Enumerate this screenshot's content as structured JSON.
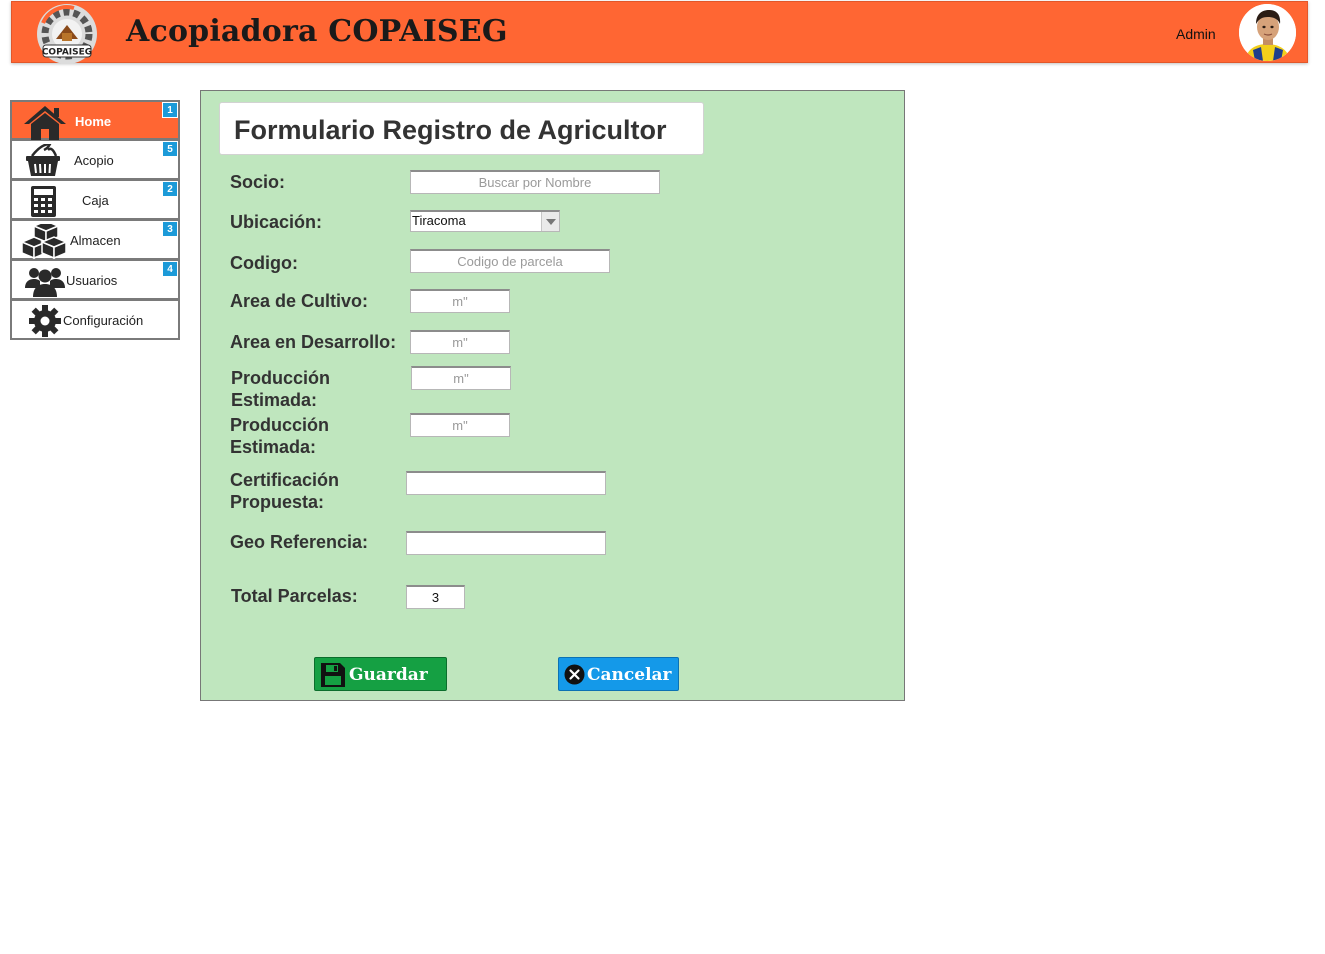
{
  "header": {
    "title": "Acopiadora COPAISEG",
    "logo_text": "COPAISEG",
    "user_label": "Admin",
    "bg_color": "#ff6633"
  },
  "sidebar": {
    "items": [
      {
        "label": "Home",
        "badge": "1",
        "icon": "home-icon",
        "active": true
      },
      {
        "label": "Acopio",
        "badge": "5",
        "icon": "basket-icon",
        "active": false
      },
      {
        "label": "Caja",
        "badge": "2",
        "icon": "calculator-icon",
        "active": false
      },
      {
        "label": "Almacen",
        "badge": "3",
        "icon": "boxes-icon",
        "active": false
      },
      {
        "label": "Usuarios",
        "badge": "4",
        "icon": "users-icon",
        "active": false
      },
      {
        "label": "Configuración",
        "badge": "",
        "icon": "gear-icon",
        "active": false
      }
    ],
    "active_color": "#ff6633",
    "badge_color": "#1c9ad8"
  },
  "form": {
    "title": "Formulario Registro de Agricultor",
    "bg_color": "#bfe6be",
    "fields": {
      "socio": {
        "label": "Socio:",
        "placeholder": "Buscar por Nombre"
      },
      "ubicacion": {
        "label": "Ubicación:",
        "value": "Tiracoma"
      },
      "codigo": {
        "label": "Codigo:",
        "placeholder": "Codigo de parcela"
      },
      "area_cultivo": {
        "label": "Area de Cultivo:",
        "placeholder": "m\""
      },
      "area_desarrollo": {
        "label": "Area en Desarrollo:",
        "placeholder": "m\""
      },
      "produccion_1": {
        "label_line1": "Producción",
        "label_line2": "Estimada:",
        "placeholder": "m\""
      },
      "produccion_2": {
        "label_line1": "Producción",
        "label_line2": "Estimada:",
        "placeholder": "m\""
      },
      "certificacion": {
        "label_line1": "Certificación",
        "label_line2": "Propuesta:",
        "value": ""
      },
      "geo": {
        "label": "Geo Referencia:",
        "value": ""
      },
      "total_parcelas": {
        "label": "Total Parcelas:",
        "value": "3"
      }
    },
    "buttons": {
      "save_label": "Guardar",
      "cancel_label": "Cancelar",
      "save_color": "#15a043",
      "cancel_color": "#1499e9"
    }
  }
}
